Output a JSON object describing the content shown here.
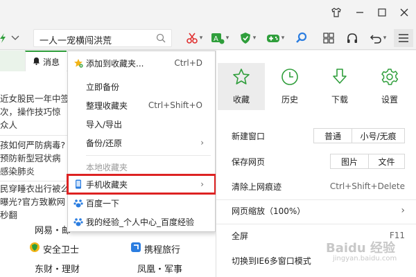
{
  "colors": {
    "accent": "#2f9e3b",
    "highlight": "#d22222",
    "blue": "#2b7de0"
  },
  "titlebar": {
    "icons": [
      "shirt-icon",
      "minimize-icon",
      "restore-icon",
      "close-icon"
    ]
  },
  "toolbar": {
    "address_text": "一人一宠横闯洪荒",
    "icons": [
      "search-icon",
      "scissors-icon",
      "translate-icon",
      "shield-icon",
      "gamepad-icon",
      "magnifier-icon",
      "grid-icon",
      "headphones-icon",
      "undo-icon",
      "menu-icon"
    ]
  },
  "page": {
    "tab_label": "消息",
    "news": [
      "近女股民一年中签",
      "次，操作技巧惊",
      "众人",
      "孩如何严防病毒?",
      "预防新型冠状病",
      "感染肺炎",
      "民穿睡衣出行被么",
      "曝光?官方致歉网",
      "秒翻"
    ],
    "sites_row1": [
      "网易・邮"
    ],
    "sites_row2": [
      "安全卫士",
      "携程旅行"
    ],
    "sites_row3": [
      "东财・理财",
      "凤凰・军事"
    ]
  },
  "menu": {
    "items": [
      {
        "label": "添加到收藏夹...",
        "shortcut": "Ctrl+D",
        "icon": "star-add-icon"
      },
      {
        "label": "立即备份"
      },
      {
        "label": "整理收藏夹",
        "shortcut": "Ctrl+Shift+O"
      },
      {
        "label": "导入/导出"
      },
      {
        "label": "备份/还原",
        "arrow": "›"
      },
      {
        "label": "本地收藏夹"
      },
      {
        "label": "手机收藏夹",
        "arrow": "›",
        "icon": "phone-icon"
      },
      {
        "label": "百度一下",
        "icon": "baidu-paw-icon"
      },
      {
        "label": "我的经验_个人中心_百度经验",
        "icon": "baidu-paw-icon"
      }
    ]
  },
  "panel": {
    "quick": [
      {
        "label": "收藏",
        "icon": "star-icon"
      },
      {
        "label": "历史",
        "icon": "clock-icon"
      },
      {
        "label": "下载",
        "icon": "download-icon"
      },
      {
        "label": "设置",
        "icon": "gear-icon"
      }
    ],
    "new_window": {
      "label": "新建窗口",
      "normal": "普通",
      "small": "小号/无痕"
    },
    "save_page": {
      "label": "保存网页",
      "image": "图片",
      "file": "文件"
    },
    "clear": {
      "label": "清除上网痕迹",
      "shortcut": "Ctrl+Shift+Delete"
    },
    "zoom": {
      "label": "网页缩放（100%）",
      "arrow": "›"
    },
    "fullscreen": {
      "label": "全屏",
      "shortcut": "F11"
    },
    "ie6": {
      "label": "切换到IE6多窗口模式"
    }
  },
  "watermark": {
    "brand": "Baidu 经验",
    "sub": "jingyan.baidu.com"
  }
}
